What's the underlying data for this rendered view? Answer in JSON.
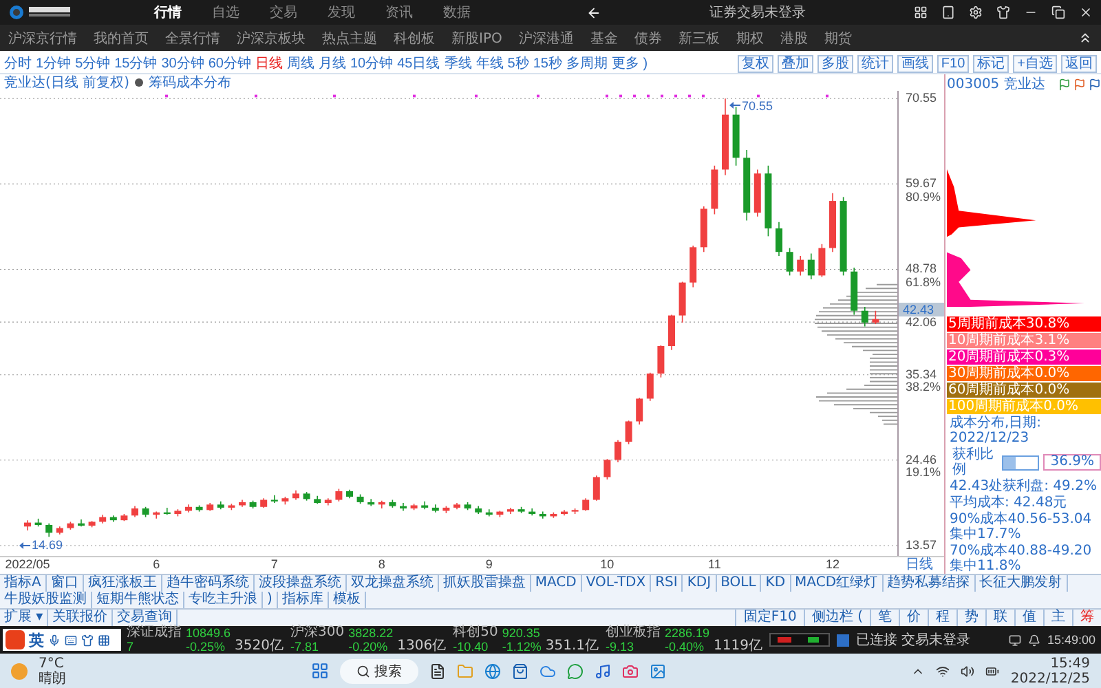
{
  "title_bar": {
    "nav": [
      {
        "label": "行情",
        "selected": true
      },
      {
        "label": "自选",
        "selected": false
      },
      {
        "label": "交易",
        "selected": false
      },
      {
        "label": "发现",
        "selected": false
      },
      {
        "label": "资讯",
        "selected": false
      },
      {
        "label": "数据",
        "selected": false
      }
    ],
    "login_status": "证券交易未登录"
  },
  "menu_bar": {
    "items": [
      "沪深京行情",
      "我的首页",
      "全景行情",
      "沪深京板块",
      "热点主题",
      "科创板",
      "新股IPO",
      "沪深港通",
      "基金",
      "债券",
      "新三板",
      "期权",
      "港股",
      "期货"
    ]
  },
  "period_toolbar": {
    "periods": [
      {
        "label": "分时",
        "selected": false
      },
      {
        "label": "1分钟",
        "selected": false
      },
      {
        "label": "5分钟",
        "selected": false
      },
      {
        "label": "15分钟",
        "selected": false
      },
      {
        "label": "30分钟",
        "selected": false
      },
      {
        "label": "60分钟",
        "selected": false
      },
      {
        "label": "日线",
        "selected": true
      },
      {
        "label": "周线",
        "selected": false
      },
      {
        "label": "月线",
        "selected": false
      },
      {
        "label": "10分钟",
        "selected": false
      },
      {
        "label": "45日线",
        "selected": false
      },
      {
        "label": "季线",
        "selected": false
      },
      {
        "label": "年线",
        "selected": false
      },
      {
        "label": "5秒",
        "selected": false
      },
      {
        "label": "15秒",
        "selected": false
      },
      {
        "label": "多周期",
        "selected": false
      },
      {
        "label": "更多 )",
        "selected": false
      }
    ],
    "buttons": [
      "复权",
      "叠加",
      "多股",
      "统计",
      "画线",
      "F10",
      "标记",
      "+自选",
      "返回"
    ]
  },
  "stock": {
    "code": "003005 竞业达"
  },
  "chart": {
    "title": "竞业达(日线 前复权)",
    "overlay": "筹码成本分布",
    "current_price": "42.43",
    "fib_labels": [
      "80.9%",
      "61.8%",
      "38.2%",
      "19.1%"
    ],
    "chart_data": {
      "type": "candlestick",
      "ylim": [
        13.57,
        70.55
      ],
      "grid": true,
      "yticks": [
        70.55,
        59.67,
        48.78,
        42.06,
        35.34,
        24.46,
        13.57
      ],
      "categories": [
        "2022/05",
        null,
        null,
        null,
        null,
        null,
        null,
        null,
        null,
        null,
        null,
        null,
        "6",
        null,
        null,
        null,
        null,
        null,
        null,
        null,
        null,
        null,
        null,
        "7",
        null,
        null,
        null,
        null,
        null,
        null,
        null,
        null,
        null,
        "8",
        null,
        null,
        null,
        null,
        null,
        null,
        null,
        null,
        null,
        "9",
        null,
        null,
        null,
        null,
        null,
        null,
        null,
        null,
        null,
        null,
        "10",
        null,
        null,
        null,
        null,
        null,
        null,
        null,
        null,
        null,
        "11",
        null,
        null,
        null,
        null,
        null,
        null,
        null,
        null,
        null,
        null,
        "12",
        null,
        null,
        null,
        null
      ],
      "ohlc": [
        [
          16.0,
          16.8,
          15.5,
          16.5
        ],
        [
          16.5,
          17.0,
          16.0,
          16.2
        ],
        [
          16.2,
          16.4,
          14.69,
          15.2
        ],
        [
          15.2,
          16.0,
          15.0,
          15.8
        ],
        [
          15.8,
          16.6,
          15.6,
          16.4
        ],
        [
          16.4,
          16.9,
          16.0,
          16.1
        ],
        [
          16.1,
          16.7,
          15.9,
          16.6
        ],
        [
          16.6,
          17.5,
          16.4,
          17.2
        ],
        [
          17.2,
          17.4,
          16.6,
          16.8
        ],
        [
          16.8,
          17.6,
          16.7,
          17.4
        ],
        [
          17.4,
          18.6,
          17.2,
          18.3
        ],
        [
          18.3,
          18.5,
          17.2,
          17.5
        ],
        [
          17.5,
          17.9,
          17.0,
          17.8
        ],
        [
          17.8,
          18.4,
          17.5,
          17.6
        ],
        [
          17.6,
          18.2,
          17.3,
          18.0
        ],
        [
          18.0,
          18.8,
          17.8,
          18.5
        ],
        [
          18.5,
          18.7,
          17.9,
          18.1
        ],
        [
          18.1,
          19.0,
          18.0,
          18.8
        ],
        [
          18.8,
          19.2,
          18.2,
          18.4
        ],
        [
          18.4,
          18.9,
          18.1,
          18.7
        ],
        [
          18.7,
          19.4,
          18.5,
          19.1
        ],
        [
          19.1,
          19.3,
          18.3,
          18.5
        ],
        [
          18.5,
          19.6,
          18.4,
          19.4
        ],
        [
          19.4,
          20.0,
          19.0,
          19.2
        ],
        [
          19.2,
          19.8,
          18.8,
          19.6
        ],
        [
          19.6,
          20.6,
          19.4,
          20.2
        ],
        [
          20.2,
          20.4,
          19.3,
          19.5
        ],
        [
          19.5,
          19.9,
          18.9,
          19.0
        ],
        [
          19.0,
          19.6,
          18.7,
          19.4
        ],
        [
          19.4,
          20.8,
          19.2,
          20.5
        ],
        [
          20.5,
          20.7,
          19.6,
          19.8
        ],
        [
          19.8,
          20.1,
          18.9,
          19.1
        ],
        [
          19.1,
          19.5,
          18.6,
          18.8
        ],
        [
          18.8,
          19.3,
          18.3,
          19.1
        ],
        [
          19.1,
          19.4,
          18.4,
          18.6
        ],
        [
          18.6,
          19.0,
          18.0,
          18.3
        ],
        [
          18.3,
          18.9,
          18.1,
          18.7
        ],
        [
          18.7,
          19.2,
          18.2,
          18.4
        ],
        [
          18.4,
          18.8,
          17.8,
          18.0
        ],
        [
          18.0,
          18.6,
          17.7,
          18.4
        ],
        [
          18.4,
          19.0,
          18.2,
          18.8
        ],
        [
          18.8,
          19.1,
          18.1,
          18.3
        ],
        [
          18.3,
          18.6,
          17.6,
          17.8
        ],
        [
          17.8,
          18.2,
          17.3,
          17.5
        ],
        [
          17.5,
          18.0,
          17.2,
          17.9
        ],
        [
          17.9,
          18.4,
          17.6,
          18.2
        ],
        [
          18.2,
          18.5,
          17.7,
          17.9
        ],
        [
          17.9,
          18.3,
          17.4,
          17.6
        ],
        [
          17.6,
          17.9,
          17.0,
          17.3
        ],
        [
          17.3,
          17.8,
          17.1,
          17.6
        ],
        [
          17.6,
          18.1,
          17.4,
          17.9
        ],
        [
          17.9,
          18.3,
          17.6,
          18.1
        ],
        [
          18.1,
          19.6,
          18.0,
          19.4
        ],
        [
          19.4,
          22.5,
          19.3,
          22.3
        ],
        [
          22.3,
          24.6,
          22.0,
          24.5
        ],
        [
          24.5,
          27.0,
          24.2,
          26.8
        ],
        [
          26.8,
          29.5,
          26.5,
          29.4
        ],
        [
          29.4,
          32.4,
          29.0,
          32.3
        ],
        [
          32.3,
          35.6,
          32.0,
          35.5
        ],
        [
          35.5,
          39.1,
          35.0,
          39.0
        ],
        [
          39.0,
          43.0,
          38.5,
          42.9
        ],
        [
          42.9,
          47.2,
          42.0,
          47.1
        ],
        [
          47.1,
          51.8,
          46.5,
          51.6
        ],
        [
          51.6,
          56.8,
          51.0,
          56.5
        ],
        [
          56.5,
          62.0,
          55.8,
          61.5
        ],
        [
          61.5,
          70.55,
          60.8,
          68.5
        ],
        [
          68.5,
          69.5,
          62.0,
          63.0
        ],
        [
          63.0,
          64.0,
          55.0,
          56.0
        ],
        [
          56.0,
          61.5,
          55.5,
          61.0
        ],
        [
          61.0,
          62.0,
          53.0,
          54.0
        ],
        [
          54.0,
          54.8,
          50.5,
          51.0
        ],
        [
          51.0,
          51.5,
          48.0,
          48.5
        ],
        [
          48.5,
          50.5,
          48.0,
          50.0
        ],
        [
          50.0,
          50.8,
          47.5,
          48.0
        ],
        [
          48.0,
          52.0,
          47.8,
          51.5
        ],
        [
          51.5,
          58.5,
          51.0,
          57.5
        ],
        [
          57.5,
          58.0,
          48.0,
          48.5
        ],
        [
          48.5,
          49.0,
          43.0,
          43.5
        ],
        [
          43.5,
          44.0,
          41.5,
          42.0
        ],
        [
          42.0,
          43.5,
          41.8,
          42.43
        ]
      ]
    },
    "high_label": "70.55",
    "low_label": "14.69",
    "period_label": "日线"
  },
  "cost_panel": {
    "periods": [
      {
        "label": "5周期前成本30.8%",
        "color": "#ff0000"
      },
      {
        "label": "10周期前成本3.1%",
        "color": "#ff8080"
      },
      {
        "label": "20周期前成本0.3%",
        "color": "#ff0099"
      },
      {
        "label": "30周期前成本0.0%",
        "color": "#ff6600"
      },
      {
        "label": "60周期前成本0.0%",
        "color": "#a07010"
      },
      {
        "label": "100周期前成本0.0%",
        "color": "#ffc000"
      }
    ],
    "date_line": "成本分布,日期: 2022/12/23",
    "profit_label": "获利比例",
    "profit": {
      "level": 0.369,
      "reading": "36.9%"
    },
    "lines": [
      "42.43处获利盘: 49.2%",
      "平均成本: 42.48元",
      "90%成本40.56-53.04集中17.7%",
      "70%成本40.88-49.20集中11.8%"
    ]
  },
  "indicator_tabs": [
    "指标A",
    "窗口",
    "疯狂涨板王",
    "趋牛密码系统",
    "波段操盘系统",
    "双龙操盘系统",
    "抓妖股雷操盘",
    "MACD",
    "VOL-TDX",
    "RSI",
    "KDJ",
    "BOLL",
    "KD",
    "MACD红绿灯",
    "趋势私募结探",
    "长征大鹏发射",
    "牛股妖股监测",
    "短期牛熊状态",
    "专吃主升浪",
    ")",
    "指标库",
    "模板"
  ],
  "extra_tabs": [
    "扩展 ▾",
    "关联报价",
    "交易查询"
  ],
  "side_tabs": [
    {
      "label": "固定F10",
      "selected": false
    },
    {
      "label": "侧边栏 (",
      "selected": false
    },
    {
      "label": "笔",
      "selected": false
    },
    {
      "label": "价",
      "selected": false
    },
    {
      "label": "程",
      "selected": false
    },
    {
      "label": "势",
      "selected": false
    },
    {
      "label": "联",
      "selected": false
    },
    {
      "label": "值",
      "selected": false
    },
    {
      "label": "主",
      "selected": false
    },
    {
      "label": "筹",
      "selected": true
    }
  ],
  "status_bar": {
    "indices": [
      {
        "name": "深证成指",
        "value": "10849.6",
        "change": "7",
        "percent": "-0.25%",
        "amount": "3520亿"
      },
      {
        "name": "沪深300",
        "value": "3828.22",
        "change": "-7.81",
        "percent": "-0.20%",
        "amount": "1306亿"
      },
      {
        "name": "科创50",
        "value": "920.35",
        "change": "-10.40",
        "percent": "-1.12%",
        "amount": "351.1亿"
      },
      {
        "name": "创业板指",
        "value": "2286.19",
        "change": "-9.13",
        "percent": "-0.40%",
        "amount": "1119亿"
      }
    ],
    "connection": "已连接 交易未登录",
    "time": "15:49:00"
  },
  "ime": {
    "mode": "英"
  },
  "taskbar": {
    "weather": {
      "temp": "7°C",
      "desc": "晴朗"
    },
    "search": "搜索",
    "time": "15:49",
    "date": "2022/12/25"
  }
}
